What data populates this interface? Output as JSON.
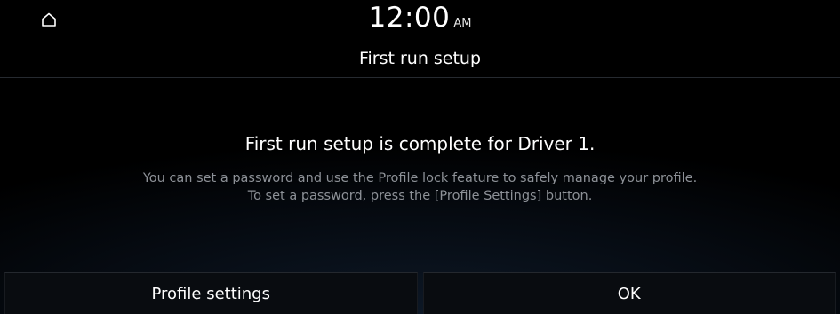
{
  "status_bar": {
    "home_icon": "home-icon",
    "time": "12:00",
    "ampm": "AM"
  },
  "header": {
    "title": "First run setup"
  },
  "main": {
    "heading": "First run setup is complete for Driver 1.",
    "description_line1": "You can set a password and use the Profile lock feature to safely manage your profile.",
    "description_line2": "To set a password, press the [Profile Settings] button."
  },
  "buttons": {
    "profile_settings": "Profile settings",
    "ok": "OK"
  },
  "colors": {
    "background": "#000000",
    "text_primary": "#ffffff",
    "text_secondary": "#8d9197"
  }
}
